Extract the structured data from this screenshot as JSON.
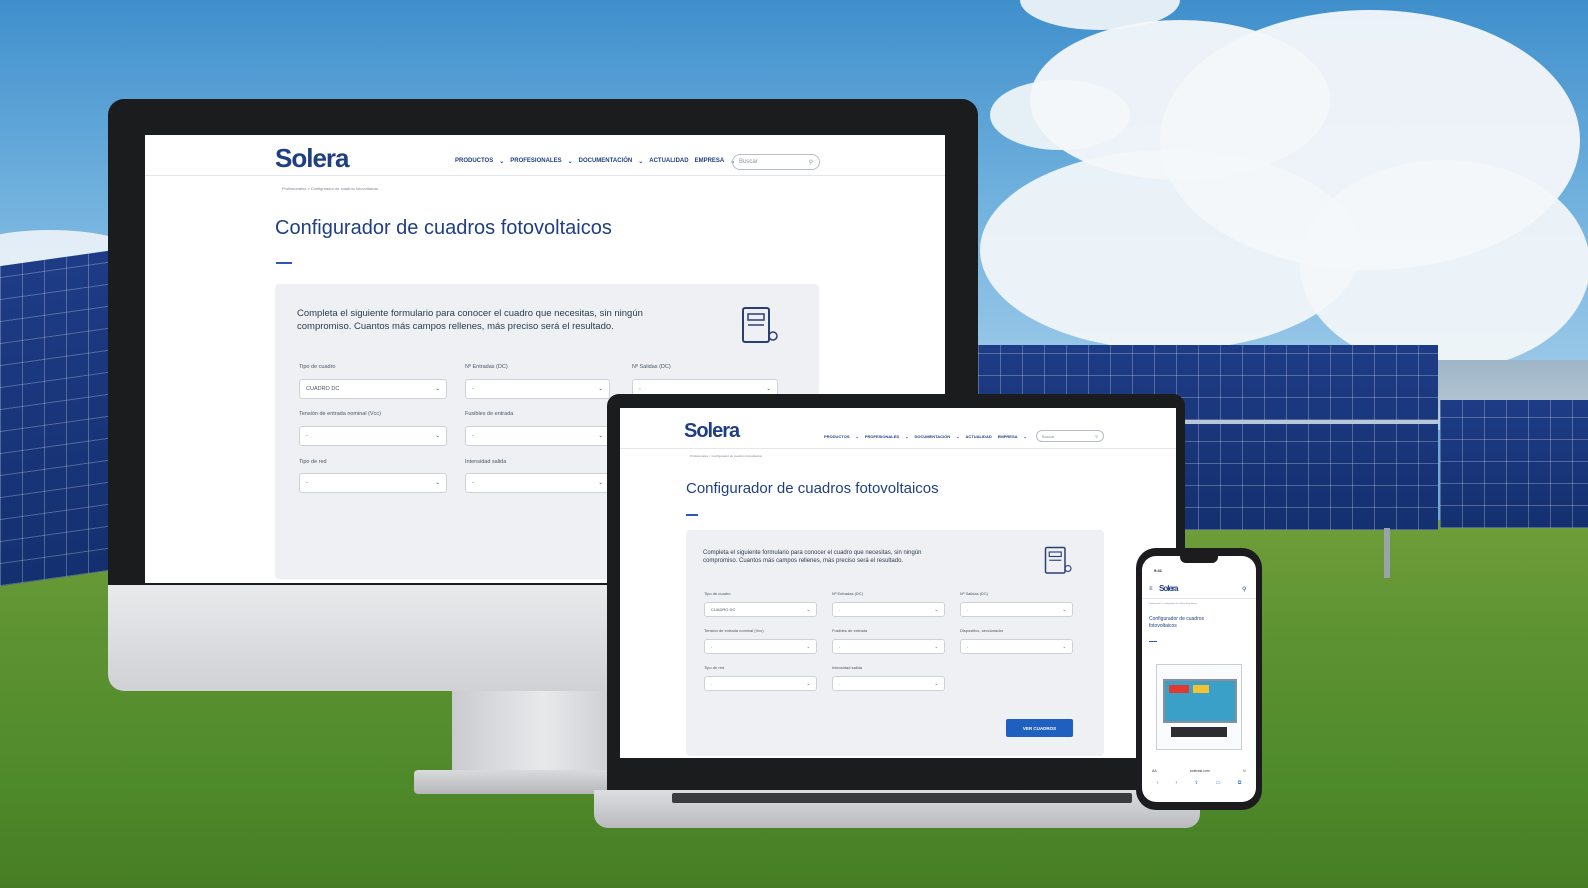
{
  "brand": "Solera",
  "nav": [
    "PRODUCTOS",
    "PROFESIONALES",
    "DOCUMENTACIÓN",
    "ACTUALIDAD",
    "EMPRESA"
  ],
  "search_placeholder": "Buscar",
  "breadcrumb": "Profesionales > Configurador de cuadros fotovoltaicos",
  "page_title": "Configurador de cuadros fotovoltaicos",
  "intro_line1": "Completa el siguiente formulario para conocer el cuadro que necesitas, sin ningún",
  "intro_line2": "compromiso. Cuantos más campos rellenes, más preciso será el resultado.",
  "fields": {
    "tipo_cuadro": {
      "label": "Tipo de cuadro",
      "value": "CUADRO DC"
    },
    "entradas": {
      "label": "Nº Entradas (DC)",
      "value": "-"
    },
    "salidas": {
      "label": "Nº Salidas (DC)",
      "value": "-"
    },
    "tension": {
      "label": "Tensión de entrada nominal (Vcc)",
      "value": "-"
    },
    "fusibles": {
      "label": "Fusibles de entrada",
      "value": "-"
    },
    "dispositivo": {
      "label": "Dispositivo, seccionador",
      "value": "-"
    },
    "tipo_red": {
      "label": "Tipo de red",
      "value": "-"
    },
    "intensidad": {
      "label": "Intensidad salida",
      "value": "-"
    }
  },
  "submit_label": "VER CUADROS",
  "phone": {
    "time": "9:41",
    "title": "Configurador de cuadros fotovoltaicos",
    "url": "solerasl.com",
    "aa": "AA"
  },
  "colors": {
    "brand": "#1f3f82",
    "button": "#1f5fbf"
  }
}
